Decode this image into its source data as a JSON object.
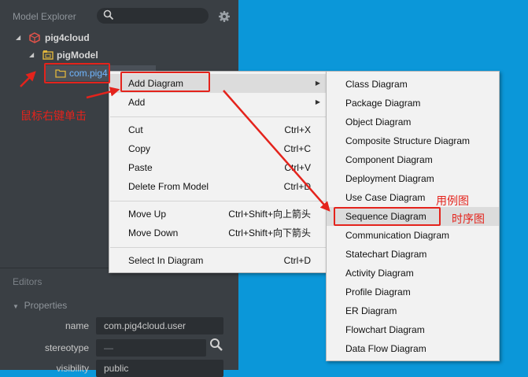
{
  "model_explorer": {
    "title": "Model Explorer",
    "search_value": "",
    "tree": [
      {
        "label": "pig4cloud"
      },
      {
        "label": "pigModel"
      },
      {
        "label": "com.pig4"
      }
    ]
  },
  "editors": {
    "title": "Editors",
    "properties_title": "Properties",
    "rows": [
      {
        "label": "name",
        "value": "com.pig4cloud.user"
      },
      {
        "label": "stereotype",
        "value": "—"
      },
      {
        "label": "visibility",
        "value": "public"
      }
    ]
  },
  "context_menu": {
    "items": [
      {
        "label": "Add Diagram",
        "shortcut": ""
      },
      {
        "label": "Add",
        "shortcut": ""
      },
      {
        "label": "Cut",
        "shortcut": "Ctrl+X"
      },
      {
        "label": "Copy",
        "shortcut": "Ctrl+C"
      },
      {
        "label": "Paste",
        "shortcut": "Ctrl+V"
      },
      {
        "label": "Delete From Model",
        "shortcut": "Ctrl+D"
      },
      {
        "label": "Move Up",
        "shortcut": "Ctrl+Shift+向上箭头"
      },
      {
        "label": "Move Down",
        "shortcut": "Ctrl+Shift+向下箭头"
      },
      {
        "label": "Select In Diagram",
        "shortcut": "Ctrl+D"
      }
    ]
  },
  "submenu": {
    "items": [
      "Class Diagram",
      "Package Diagram",
      "Object Diagram",
      "Composite Structure Diagram",
      "Component Diagram",
      "Deployment Diagram",
      "Use Case Diagram",
      "Sequence Diagram",
      "Communication Diagram",
      "Statechart Diagram",
      "Activity Diagram",
      "Profile Diagram",
      "ER Diagram",
      "Flowchart Diagram",
      "Data Flow Diagram"
    ]
  },
  "annotations": {
    "right_click": "鼠标右键单击",
    "use_case": "用例图",
    "sequence": "时序图"
  },
  "colors": {
    "annotation_red": "#e4231c",
    "desktop_blue": "#0b97d9",
    "sidebar_bg": "#3a3f44"
  }
}
